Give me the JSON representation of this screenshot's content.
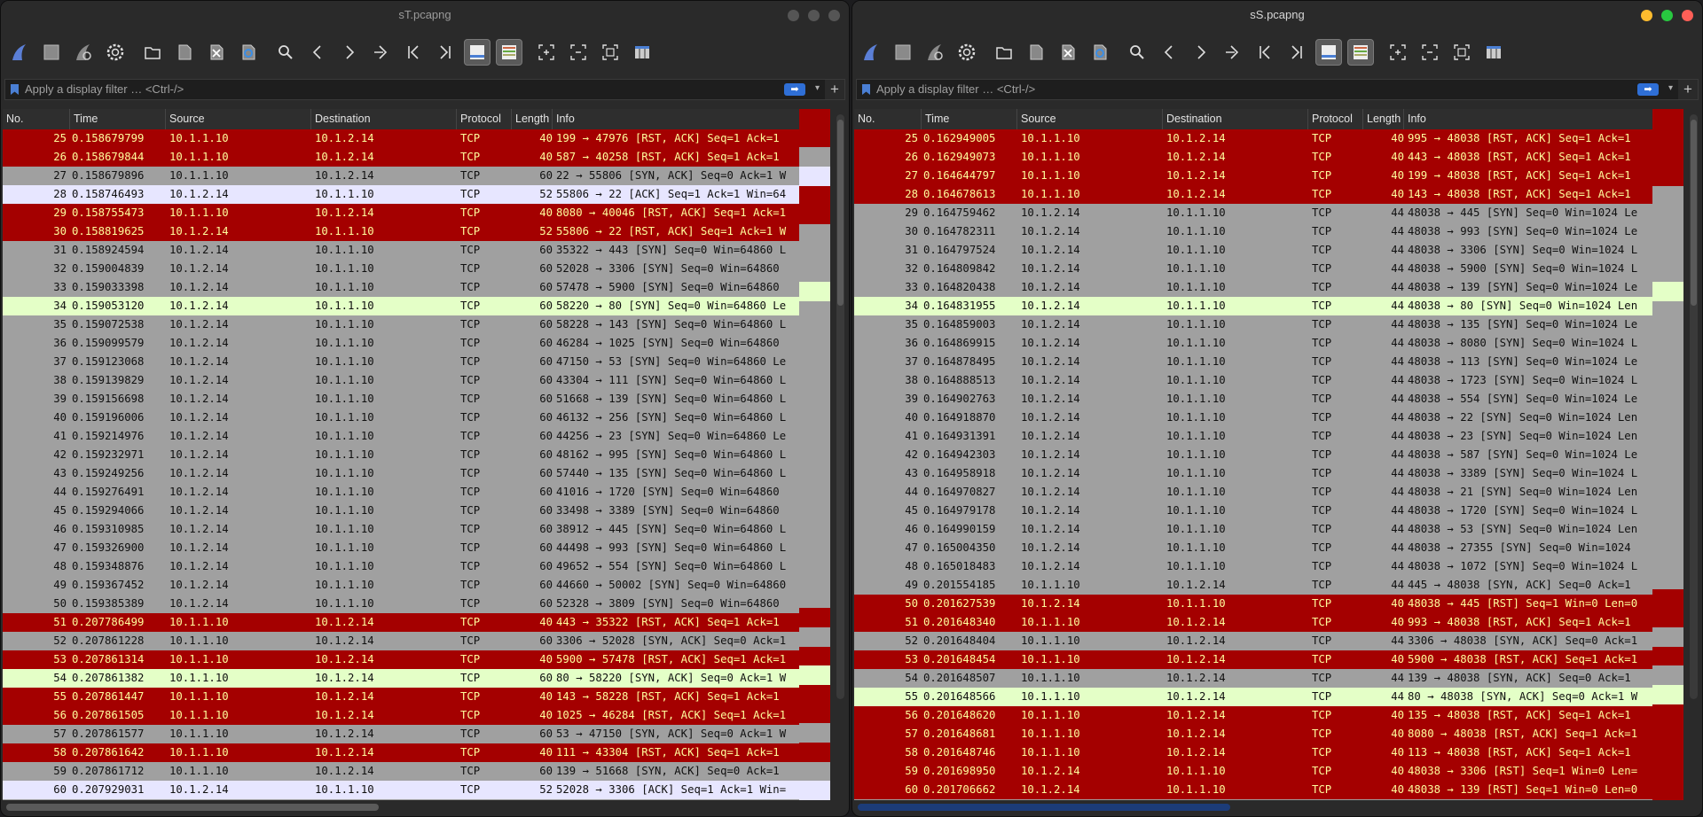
{
  "left": {
    "title": "sT.pcapng",
    "filter_placeholder": "Apply a display filter … <Ctrl-/>",
    "rows": [
      {
        "no": "25",
        "time": "0.158679799",
        "src": "10.1.1.10",
        "dst": "10.1.2.14",
        "proto": "TCP",
        "len": "40",
        "info": "199 → 47976 [RST, ACK] Seq=1 Ack=1",
        "color": "red"
      },
      {
        "no": "26",
        "time": "0.158679844",
        "src": "10.1.1.10",
        "dst": "10.1.2.14",
        "proto": "TCP",
        "len": "40",
        "info": "587 → 40258 [RST, ACK] Seq=1 Ack=1",
        "color": "red"
      },
      {
        "no": "27",
        "time": "0.158679896",
        "src": "10.1.1.10",
        "dst": "10.1.2.14",
        "proto": "TCP",
        "len": "60",
        "info": "22 → 55806 [SYN, ACK] Seq=0 Ack=1 W",
        "color": "gray"
      },
      {
        "no": "28",
        "time": "0.158746493",
        "src": "10.1.2.14",
        "dst": "10.1.1.10",
        "proto": "TCP",
        "len": "52",
        "info": "55806 → 22 [ACK] Seq=1 Ack=1 Win=64",
        "color": "lav"
      },
      {
        "no": "29",
        "time": "0.158755473",
        "src": "10.1.1.10",
        "dst": "10.1.2.14",
        "proto": "TCP",
        "len": "40",
        "info": "8080 → 40046 [RST, ACK] Seq=1 Ack=1",
        "color": "red"
      },
      {
        "no": "30",
        "time": "0.158819625",
        "src": "10.1.2.14",
        "dst": "10.1.1.10",
        "proto": "TCP",
        "len": "52",
        "info": "55806 → 22 [RST, ACK] Seq=1 Ack=1 W",
        "color": "red"
      },
      {
        "no": "31",
        "time": "0.158924594",
        "src": "10.1.2.14",
        "dst": "10.1.1.10",
        "proto": "TCP",
        "len": "60",
        "info": "35322 → 443 [SYN] Seq=0 Win=64860 L",
        "color": "gray"
      },
      {
        "no": "32",
        "time": "0.159004839",
        "src": "10.1.2.14",
        "dst": "10.1.1.10",
        "proto": "TCP",
        "len": "60",
        "info": "52028 → 3306 [SYN] Seq=0 Win=64860",
        "color": "gray"
      },
      {
        "no": "33",
        "time": "0.159033398",
        "src": "10.1.2.14",
        "dst": "10.1.1.10",
        "proto": "TCP",
        "len": "60",
        "info": "57478 → 5900 [SYN] Seq=0 Win=64860",
        "color": "gray"
      },
      {
        "no": "34",
        "time": "0.159053120",
        "src": "10.1.2.14",
        "dst": "10.1.1.10",
        "proto": "TCP",
        "len": "60",
        "info": "58220 → 80 [SYN] Seq=0 Win=64860 Le",
        "color": "green"
      },
      {
        "no": "35",
        "time": "0.159072538",
        "src": "10.1.2.14",
        "dst": "10.1.1.10",
        "proto": "TCP",
        "len": "60",
        "info": "58228 → 143 [SYN] Seq=0 Win=64860 L",
        "color": "gray"
      },
      {
        "no": "36",
        "time": "0.159099579",
        "src": "10.1.2.14",
        "dst": "10.1.1.10",
        "proto": "TCP",
        "len": "60",
        "info": "46284 → 1025 [SYN] Seq=0 Win=64860",
        "color": "gray"
      },
      {
        "no": "37",
        "time": "0.159123068",
        "src": "10.1.2.14",
        "dst": "10.1.1.10",
        "proto": "TCP",
        "len": "60",
        "info": "47150 → 53 [SYN] Seq=0 Win=64860 Le",
        "color": "gray"
      },
      {
        "no": "38",
        "time": "0.159139829",
        "src": "10.1.2.14",
        "dst": "10.1.1.10",
        "proto": "TCP",
        "len": "60",
        "info": "43304 → 111 [SYN] Seq=0 Win=64860 L",
        "color": "gray"
      },
      {
        "no": "39",
        "time": "0.159156698",
        "src": "10.1.2.14",
        "dst": "10.1.1.10",
        "proto": "TCP",
        "len": "60",
        "info": "51668 → 139 [SYN] Seq=0 Win=64860 L",
        "color": "gray"
      },
      {
        "no": "40",
        "time": "0.159196006",
        "src": "10.1.2.14",
        "dst": "10.1.1.10",
        "proto": "TCP",
        "len": "60",
        "info": "46132 → 256 [SYN] Seq=0 Win=64860 L",
        "color": "gray"
      },
      {
        "no": "41",
        "time": "0.159214976",
        "src": "10.1.2.14",
        "dst": "10.1.1.10",
        "proto": "TCP",
        "len": "60",
        "info": "44256 → 23 [SYN] Seq=0 Win=64860 Le",
        "color": "gray"
      },
      {
        "no": "42",
        "time": "0.159232971",
        "src": "10.1.2.14",
        "dst": "10.1.1.10",
        "proto": "TCP",
        "len": "60",
        "info": "48162 → 995 [SYN] Seq=0 Win=64860 L",
        "color": "gray"
      },
      {
        "no": "43",
        "time": "0.159249256",
        "src": "10.1.2.14",
        "dst": "10.1.1.10",
        "proto": "TCP",
        "len": "60",
        "info": "57440 → 135 [SYN] Seq=0 Win=64860 L",
        "color": "gray"
      },
      {
        "no": "44",
        "time": "0.159276491",
        "src": "10.1.2.14",
        "dst": "10.1.1.10",
        "proto": "TCP",
        "len": "60",
        "info": "41016 → 1720 [SYN] Seq=0 Win=64860",
        "color": "gray"
      },
      {
        "no": "45",
        "time": "0.159294066",
        "src": "10.1.2.14",
        "dst": "10.1.1.10",
        "proto": "TCP",
        "len": "60",
        "info": "33498 → 3389 [SYN] Seq=0 Win=64860",
        "color": "gray"
      },
      {
        "no": "46",
        "time": "0.159310985",
        "src": "10.1.2.14",
        "dst": "10.1.1.10",
        "proto": "TCP",
        "len": "60",
        "info": "38912 → 445 [SYN] Seq=0 Win=64860 L",
        "color": "gray"
      },
      {
        "no": "47",
        "time": "0.159326900",
        "src": "10.1.2.14",
        "dst": "10.1.1.10",
        "proto": "TCP",
        "len": "60",
        "info": "44498 → 993 [SYN] Seq=0 Win=64860 L",
        "color": "gray"
      },
      {
        "no": "48",
        "time": "0.159348876",
        "src": "10.1.2.14",
        "dst": "10.1.1.10",
        "proto": "TCP",
        "len": "60",
        "info": "49652 → 554 [SYN] Seq=0 Win=64860 L",
        "color": "gray"
      },
      {
        "no": "49",
        "time": "0.159367452",
        "src": "10.1.2.14",
        "dst": "10.1.1.10",
        "proto": "TCP",
        "len": "60",
        "info": "44660 → 50002 [SYN] Seq=0 Win=64860",
        "color": "gray"
      },
      {
        "no": "50",
        "time": "0.159385389",
        "src": "10.1.2.14",
        "dst": "10.1.1.10",
        "proto": "TCP",
        "len": "60",
        "info": "52328 → 3809 [SYN] Seq=0 Win=64860",
        "color": "gray"
      },
      {
        "no": "51",
        "time": "0.207786499",
        "src": "10.1.1.10",
        "dst": "10.1.2.14",
        "proto": "TCP",
        "len": "40",
        "info": "443 → 35322 [RST, ACK] Seq=1 Ack=1",
        "color": "red"
      },
      {
        "no": "52",
        "time": "0.207861228",
        "src": "10.1.1.10",
        "dst": "10.1.2.14",
        "proto": "TCP",
        "len": "60",
        "info": "3306 → 52028 [SYN, ACK] Seq=0 Ack=1",
        "color": "gray"
      },
      {
        "no": "53",
        "time": "0.207861314",
        "src": "10.1.1.10",
        "dst": "10.1.2.14",
        "proto": "TCP",
        "len": "40",
        "info": "5900 → 57478 [RST, ACK] Seq=1 Ack=1",
        "color": "red"
      },
      {
        "no": "54",
        "time": "0.207861382",
        "src": "10.1.1.10",
        "dst": "10.1.2.14",
        "proto": "TCP",
        "len": "60",
        "info": "80 → 58220 [SYN, ACK] Seq=0 Ack=1 W",
        "color": "green"
      },
      {
        "no": "55",
        "time": "0.207861447",
        "src": "10.1.1.10",
        "dst": "10.1.2.14",
        "proto": "TCP",
        "len": "40",
        "info": "143 → 58228 [RST, ACK] Seq=1 Ack=1",
        "color": "red"
      },
      {
        "no": "56",
        "time": "0.207861505",
        "src": "10.1.1.10",
        "dst": "10.1.2.14",
        "proto": "TCP",
        "len": "40",
        "info": "1025 → 46284 [RST, ACK] Seq=1 Ack=1",
        "color": "red"
      },
      {
        "no": "57",
        "time": "0.207861577",
        "src": "10.1.1.10",
        "dst": "10.1.2.14",
        "proto": "TCP",
        "len": "60",
        "info": "53 → 47150 [SYN, ACK] Seq=0 Ack=1 W",
        "color": "gray"
      },
      {
        "no": "58",
        "time": "0.207861642",
        "src": "10.1.1.10",
        "dst": "10.1.2.14",
        "proto": "TCP",
        "len": "40",
        "info": "111 → 43304 [RST, ACK] Seq=1 Ack=1",
        "color": "red"
      },
      {
        "no": "59",
        "time": "0.207861712",
        "src": "10.1.1.10",
        "dst": "10.1.2.14",
        "proto": "TCP",
        "len": "60",
        "info": "139 → 51668 [SYN, ACK] Seq=0 Ack=1",
        "color": "gray"
      },
      {
        "no": "60",
        "time": "0.207929031",
        "src": "10.1.2.14",
        "dst": "10.1.1.10",
        "proto": "TCP",
        "len": "52",
        "info": "52028 → 3306 [ACK] Seq=1 Ack=1 Win=",
        "color": "lav"
      }
    ]
  },
  "right": {
    "title": "sS.pcapng",
    "filter_placeholder": "Apply a display filter … <Ctrl-/>",
    "rows": [
      {
        "no": "25",
        "time": "0.162949005",
        "src": "10.1.1.10",
        "dst": "10.1.2.14",
        "proto": "TCP",
        "len": "40",
        "info": "995 → 48038 [RST, ACK] Seq=1 Ack=1",
        "color": "red"
      },
      {
        "no": "26",
        "time": "0.162949073",
        "src": "10.1.1.10",
        "dst": "10.1.2.14",
        "proto": "TCP",
        "len": "40",
        "info": "443 → 48038 [RST, ACK] Seq=1 Ack=1",
        "color": "red"
      },
      {
        "no": "27",
        "time": "0.164644797",
        "src": "10.1.1.10",
        "dst": "10.1.2.14",
        "proto": "TCP",
        "len": "40",
        "info": "199 → 48038 [RST, ACK] Seq=1 Ack=1",
        "color": "red"
      },
      {
        "no": "28",
        "time": "0.164678613",
        "src": "10.1.1.10",
        "dst": "10.1.2.14",
        "proto": "TCP",
        "len": "40",
        "info": "143 → 48038 [RST, ACK] Seq=1 Ack=1",
        "color": "red"
      },
      {
        "no": "29",
        "time": "0.164759462",
        "src": "10.1.2.14",
        "dst": "10.1.1.10",
        "proto": "TCP",
        "len": "44",
        "info": "48038 → 445 [SYN] Seq=0 Win=1024 Le",
        "color": "gray"
      },
      {
        "no": "30",
        "time": "0.164782311",
        "src": "10.1.2.14",
        "dst": "10.1.1.10",
        "proto": "TCP",
        "len": "44",
        "info": "48038 → 993 [SYN] Seq=0 Win=1024 Le",
        "color": "gray"
      },
      {
        "no": "31",
        "time": "0.164797524",
        "src": "10.1.2.14",
        "dst": "10.1.1.10",
        "proto": "TCP",
        "len": "44",
        "info": "48038 → 3306 [SYN] Seq=0 Win=1024 L",
        "color": "gray"
      },
      {
        "no": "32",
        "time": "0.164809842",
        "src": "10.1.2.14",
        "dst": "10.1.1.10",
        "proto": "TCP",
        "len": "44",
        "info": "48038 → 5900 [SYN] Seq=0 Win=1024 L",
        "color": "gray"
      },
      {
        "no": "33",
        "time": "0.164820438",
        "src": "10.1.2.14",
        "dst": "10.1.1.10",
        "proto": "TCP",
        "len": "44",
        "info": "48038 → 139 [SYN] Seq=0 Win=1024 Le",
        "color": "gray"
      },
      {
        "no": "34",
        "time": "0.164831955",
        "src": "10.1.2.14",
        "dst": "10.1.1.10",
        "proto": "TCP",
        "len": "44",
        "info": "48038 → 80 [SYN] Seq=0 Win=1024 Len",
        "color": "green"
      },
      {
        "no": "35",
        "time": "0.164859003",
        "src": "10.1.2.14",
        "dst": "10.1.1.10",
        "proto": "TCP",
        "len": "44",
        "info": "48038 → 135 [SYN] Seq=0 Win=1024 Le",
        "color": "gray"
      },
      {
        "no": "36",
        "time": "0.164869915",
        "src": "10.1.2.14",
        "dst": "10.1.1.10",
        "proto": "TCP",
        "len": "44",
        "info": "48038 → 8080 [SYN] Seq=0 Win=1024 L",
        "color": "gray"
      },
      {
        "no": "37",
        "time": "0.164878495",
        "src": "10.1.2.14",
        "dst": "10.1.1.10",
        "proto": "TCP",
        "len": "44",
        "info": "48038 → 113 [SYN] Seq=0 Win=1024 Le",
        "color": "gray"
      },
      {
        "no": "38",
        "time": "0.164888513",
        "src": "10.1.2.14",
        "dst": "10.1.1.10",
        "proto": "TCP",
        "len": "44",
        "info": "48038 → 1723 [SYN] Seq=0 Win=1024 L",
        "color": "gray"
      },
      {
        "no": "39",
        "time": "0.164902763",
        "src": "10.1.2.14",
        "dst": "10.1.1.10",
        "proto": "TCP",
        "len": "44",
        "info": "48038 → 554 [SYN] Seq=0 Win=1024 Le",
        "color": "gray"
      },
      {
        "no": "40",
        "time": "0.164918870",
        "src": "10.1.2.14",
        "dst": "10.1.1.10",
        "proto": "TCP",
        "len": "44",
        "info": "48038 → 22 [SYN] Seq=0 Win=1024 Len",
        "color": "gray"
      },
      {
        "no": "41",
        "time": "0.164931391",
        "src": "10.1.2.14",
        "dst": "10.1.1.10",
        "proto": "TCP",
        "len": "44",
        "info": "48038 → 23 [SYN] Seq=0 Win=1024 Len",
        "color": "gray"
      },
      {
        "no": "42",
        "time": "0.164942303",
        "src": "10.1.2.14",
        "dst": "10.1.1.10",
        "proto": "TCP",
        "len": "44",
        "info": "48038 → 587 [SYN] Seq=0 Win=1024 Le",
        "color": "gray"
      },
      {
        "no": "43",
        "time": "0.164958918",
        "src": "10.1.2.14",
        "dst": "10.1.1.10",
        "proto": "TCP",
        "len": "44",
        "info": "48038 → 3389 [SYN] Seq=0 Win=1024 L",
        "color": "gray"
      },
      {
        "no": "44",
        "time": "0.164970827",
        "src": "10.1.2.14",
        "dst": "10.1.1.10",
        "proto": "TCP",
        "len": "44",
        "info": "48038 → 21 [SYN] Seq=0 Win=1024 Len",
        "color": "gray"
      },
      {
        "no": "45",
        "time": "0.164979178",
        "src": "10.1.2.14",
        "dst": "10.1.1.10",
        "proto": "TCP",
        "len": "44",
        "info": "48038 → 1720 [SYN] Seq=0 Win=1024 L",
        "color": "gray"
      },
      {
        "no": "46",
        "time": "0.164990159",
        "src": "10.1.2.14",
        "dst": "10.1.1.10",
        "proto": "TCP",
        "len": "44",
        "info": "48038 → 53 [SYN] Seq=0 Win=1024 Len",
        "color": "gray"
      },
      {
        "no": "47",
        "time": "0.165004350",
        "src": "10.1.2.14",
        "dst": "10.1.1.10",
        "proto": "TCP",
        "len": "44",
        "info": "48038 → 27355 [SYN] Seq=0 Win=1024",
        "color": "gray"
      },
      {
        "no": "48",
        "time": "0.165018483",
        "src": "10.1.2.14",
        "dst": "10.1.1.10",
        "proto": "TCP",
        "len": "44",
        "info": "48038 → 1072 [SYN] Seq=0 Win=1024 L",
        "color": "gray"
      },
      {
        "no": "49",
        "time": "0.201554185",
        "src": "10.1.1.10",
        "dst": "10.1.2.14",
        "proto": "TCP",
        "len": "44",
        "info": "445 → 48038 [SYN, ACK] Seq=0 Ack=1",
        "color": "gray"
      },
      {
        "no": "50",
        "time": "0.201627539",
        "src": "10.1.2.14",
        "dst": "10.1.1.10",
        "proto": "TCP",
        "len": "40",
        "info": "48038 → 445 [RST] Seq=1 Win=0 Len=0",
        "color": "red"
      },
      {
        "no": "51",
        "time": "0.201648340",
        "src": "10.1.1.10",
        "dst": "10.1.2.14",
        "proto": "TCP",
        "len": "40",
        "info": "993 → 48038 [RST, ACK] Seq=1 Ack=1",
        "color": "red"
      },
      {
        "no": "52",
        "time": "0.201648404",
        "src": "10.1.1.10",
        "dst": "10.1.2.14",
        "proto": "TCP",
        "len": "44",
        "info": "3306 → 48038 [SYN, ACK] Seq=0 Ack=1",
        "color": "gray"
      },
      {
        "no": "53",
        "time": "0.201648454",
        "src": "10.1.1.10",
        "dst": "10.1.2.14",
        "proto": "TCP",
        "len": "40",
        "info": "5900 → 48038 [RST, ACK] Seq=1 Ack=1",
        "color": "red"
      },
      {
        "no": "54",
        "time": "0.201648507",
        "src": "10.1.1.10",
        "dst": "10.1.2.14",
        "proto": "TCP",
        "len": "44",
        "info": "139 → 48038 [SYN, ACK] Seq=0 Ack=1",
        "color": "gray"
      },
      {
        "no": "55",
        "time": "0.201648566",
        "src": "10.1.1.10",
        "dst": "10.1.2.14",
        "proto": "TCP",
        "len": "44",
        "info": "80 → 48038 [SYN, ACK] Seq=0 Ack=1 W",
        "color": "green"
      },
      {
        "no": "56",
        "time": "0.201648620",
        "src": "10.1.1.10",
        "dst": "10.1.2.14",
        "proto": "TCP",
        "len": "40",
        "info": "135 → 48038 [RST, ACK] Seq=1 Ack=1",
        "color": "red"
      },
      {
        "no": "57",
        "time": "0.201648681",
        "src": "10.1.1.10",
        "dst": "10.1.2.14",
        "proto": "TCP",
        "len": "40",
        "info": "8080 → 48038 [RST, ACK] Seq=1 Ack=1",
        "color": "red"
      },
      {
        "no": "58",
        "time": "0.201648746",
        "src": "10.1.1.10",
        "dst": "10.1.2.14",
        "proto": "TCP",
        "len": "40",
        "info": "113 → 48038 [RST, ACK] Seq=1 Ack=1",
        "color": "red"
      },
      {
        "no": "59",
        "time": "0.201698950",
        "src": "10.1.2.14",
        "dst": "10.1.1.10",
        "proto": "TCP",
        "len": "40",
        "info": "48038 → 3306 [RST] Seq=1 Win=0 Len=",
        "color": "red"
      },
      {
        "no": "60",
        "time": "0.201706662",
        "src": "10.1.2.14",
        "dst": "10.1.1.10",
        "proto": "TCP",
        "len": "40",
        "info": "48038 → 139 [RST] Seq=1 Win=0 Len=0",
        "color": "red"
      }
    ]
  },
  "columns": {
    "no": "No.",
    "time": "Time",
    "source": "Source",
    "destination": "Destination",
    "protocol": "Protocol",
    "length": "Length",
    "info": "Info"
  },
  "row_colors": {
    "red": "#a40000",
    "gray": "#a0a0a0",
    "green": "#e4ffc7",
    "lav": "#e7e6ff",
    "red_text": "#fffc9c"
  },
  "toolbar_icons": [
    "shark-fin-start-icon",
    "stop-capture-icon",
    "restart-capture-icon",
    "capture-options-icon",
    "open-file-icon",
    "save-file-icon",
    "close-file-icon",
    "reload-file-icon",
    "find-packet-icon",
    "go-back-icon",
    "go-forward-icon",
    "go-to-packet-icon",
    "first-packet-icon",
    "last-packet-icon",
    "autoscroll-icon",
    "colorize-icon",
    "zoom-in-icon",
    "zoom-out-icon",
    "normal-size-icon",
    "resize-columns-icon"
  ]
}
